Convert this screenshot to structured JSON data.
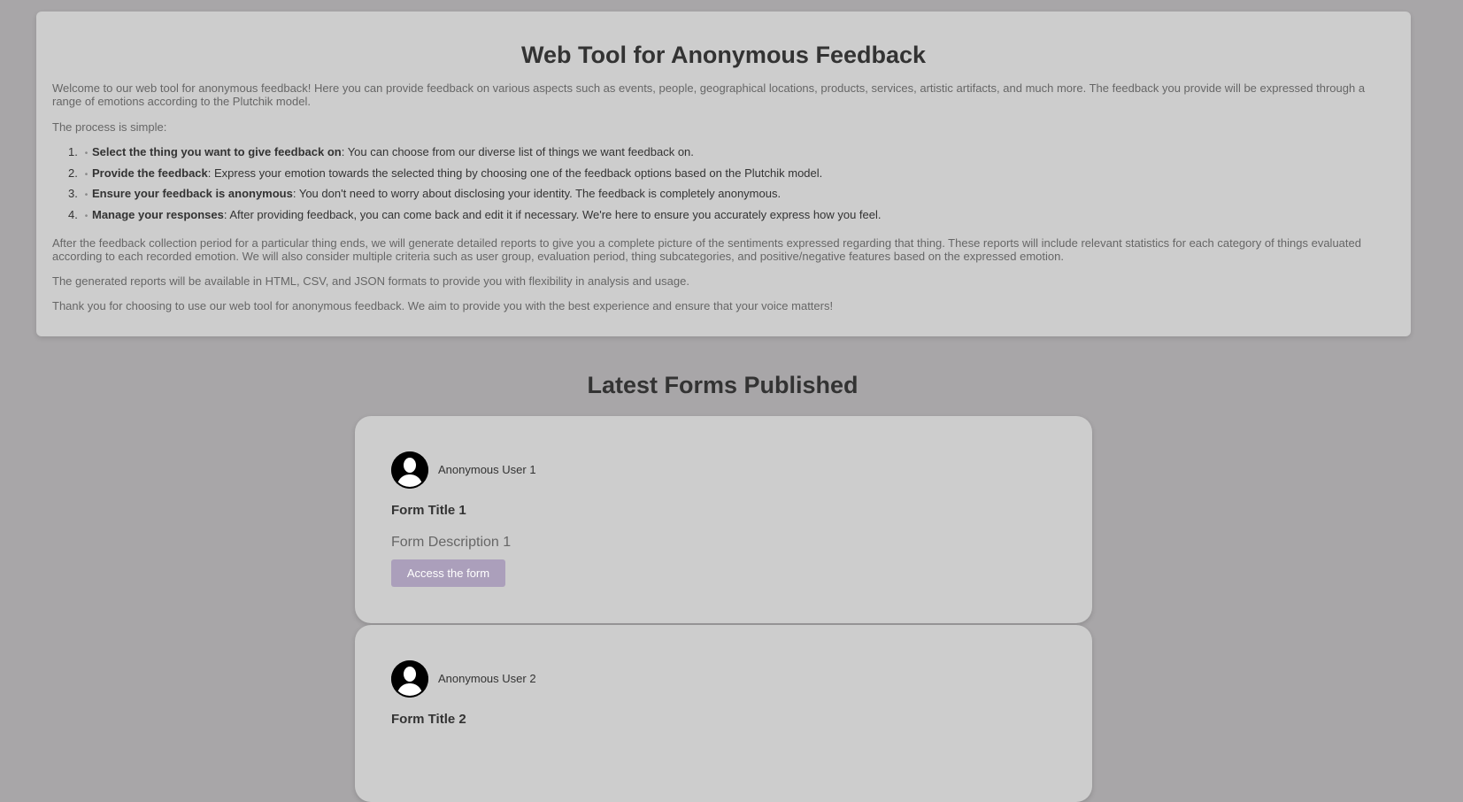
{
  "intro": {
    "title": "Web Tool for Anonymous Feedback",
    "welcome": "Welcome to our web tool for anonymous feedback! Here you can provide feedback on various aspects such as events, people, geographical locations, products, services, artistic artifacts, and much more. The feedback you provide will be expressed through a range of emotions according to the Plutchik model.",
    "process_intro": "The process is simple:",
    "steps": [
      {
        "num": "1.",
        "strong": "Select the thing you want to give feedback on",
        "rest": ": You can choose from our diverse list of things we want feedback on."
      },
      {
        "num": "2.",
        "strong": "Provide the feedback",
        "rest": ": Express your emotion towards the selected thing by choosing one of the feedback options based on the Plutchik model."
      },
      {
        "num": "3.",
        "strong": "Ensure your feedback is anonymous",
        "rest": ": You don't need to worry about disclosing your identity. The feedback is completely anonymous."
      },
      {
        "num": "4.",
        "strong": "Manage your responses",
        "rest": ": After providing feedback, you can come back and edit it if necessary. We're here to ensure you accurately express how you feel."
      }
    ],
    "after": "After the feedback collection period for a particular thing ends, we will generate detailed reports to give you a complete picture of the sentiments expressed regarding that thing. These reports will include relevant statistics for each category of things evaluated according to each recorded emotion. We will also consider multiple criteria such as user group, evaluation period, thing subcategories, and positive/negative features based on the expressed emotion.",
    "formats": "The generated reports will be available in HTML, CSV, and JSON formats to provide you with flexibility in analysis and usage.",
    "thanks": "Thank you for choosing to use our web tool for anonymous feedback. We aim to provide you with the best experience and ensure that your voice matters!"
  },
  "latest": {
    "title": "Latest Forms Published",
    "forms": [
      {
        "user": "Anonymous User 1",
        "title": "Form Title 1",
        "description": "Form Description 1",
        "button": "Access the form"
      },
      {
        "user": "Anonymous User 2",
        "title": "Form Title 2",
        "description": "",
        "button": ""
      }
    ]
  },
  "colors": {
    "page_bg": "#a8a6a8",
    "card_bg": "#cdcdcd",
    "button_bg": "#ab9fbb",
    "heading": "#333333",
    "muted_text": "#666666"
  },
  "icons": {
    "avatar": "user-silhouette-icon",
    "list_marker": "bullet-dot"
  }
}
